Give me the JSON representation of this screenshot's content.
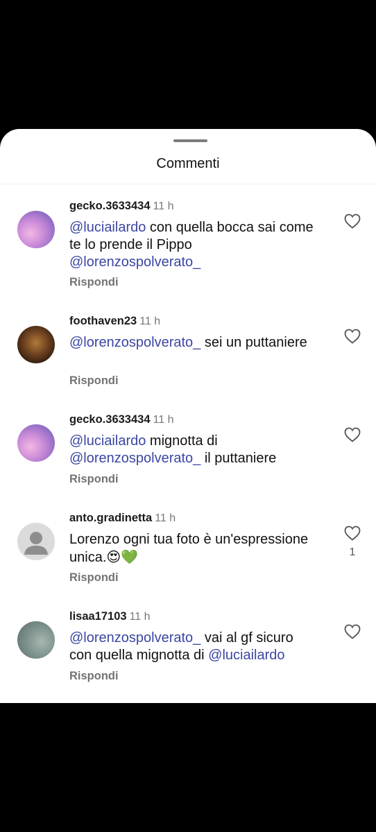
{
  "sheet": {
    "title": "Commenti"
  },
  "comments": [
    {
      "username": "gecko.3633434",
      "time": "11 h",
      "parts": [
        {
          "m": "@luciailardo"
        },
        {
          "t": " con quella bocca sai come te lo prende il Pippo "
        },
        {
          "m": "@lorenzospolverato_"
        }
      ],
      "reply": "Rispondi",
      "likes": ""
    },
    {
      "username": "foothaven23",
      "time": "11 h",
      "parts": [
        {
          "m": "@lorenzospolverato_"
        },
        {
          "t": " sei un puttaniere"
        }
      ],
      "reply": "Rispondi",
      "likes": ""
    },
    {
      "username": "gecko.3633434",
      "time": "11 h",
      "parts": [
        {
          "m": "@luciailardo"
        },
        {
          "t": " mignotta di "
        },
        {
          "m": "@lorenzospolverato_"
        },
        {
          "t": " il puttaniere"
        }
      ],
      "reply": "Rispondi",
      "likes": ""
    },
    {
      "username": "anto.gradinetta",
      "time": "11 h",
      "parts": [
        {
          "t": "Lorenzo ogni tua foto è un'espressione unica."
        },
        {
          "e": "😍💚"
        }
      ],
      "reply": "Rispondi",
      "likes": "1"
    },
    {
      "username": "lisaa17103",
      "time": "11 h",
      "parts": [
        {
          "m": "@lorenzospolverato_"
        },
        {
          "t": "  vai al gf sicuro con quella mignotta di "
        },
        {
          "m": "@luciailardo"
        }
      ],
      "reply": "Rispondi",
      "likes": ""
    }
  ]
}
